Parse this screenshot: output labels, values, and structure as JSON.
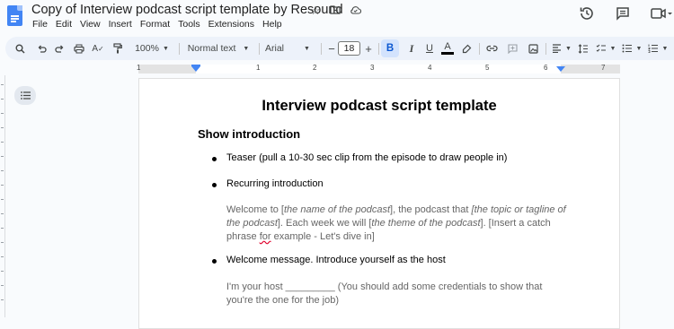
{
  "header": {
    "doc_title": "Copy of Interview podcast script template by Resound",
    "menu": [
      "File",
      "Edit",
      "View",
      "Insert",
      "Format",
      "Tools",
      "Extensions",
      "Help"
    ]
  },
  "toolbar": {
    "zoom": "100%",
    "style": "Normal text",
    "font": "Arial",
    "font_size": "18",
    "minus": "−",
    "plus": "+",
    "bold": "B",
    "italic": "I",
    "underline": "U",
    "text_color": "A"
  },
  "ruler": {
    "numbers": [
      "1",
      "1",
      "2",
      "3",
      "4",
      "5",
      "6",
      "7"
    ]
  },
  "document": {
    "title": "Interview podcast script template",
    "section": "Show introduction",
    "bullets": [
      "Teaser (pull a 10-30 sec clip from the episode to draw people in)",
      "Recurring introduction",
      "Welcome message. Introduce yourself as the host"
    ],
    "para1": {
      "l1_a": "Welcome to [",
      "l1_b": "the name of the podcast",
      "l1_c": "], the podcast that ",
      "l1_d": "[the topic or tagline of",
      "l2_a": "the podcast",
      "l2_b": "].  Each week we will [",
      "l2_c": "the theme of the podcast",
      "l2_d": "]. [Insert a catch",
      "l3_a": "phrase ",
      "l3_b": "for",
      "l3_c": " example - Let's dive in]"
    },
    "para2": {
      "l1": "I'm your host _________ (You should add some credentials to show that",
      "l2": "you're the one for the job)"
    }
  },
  "colors": {
    "accent": "#0b57d0",
    "doc_icon": "#4285f4",
    "toolbar_bg": "#edf2fa"
  }
}
